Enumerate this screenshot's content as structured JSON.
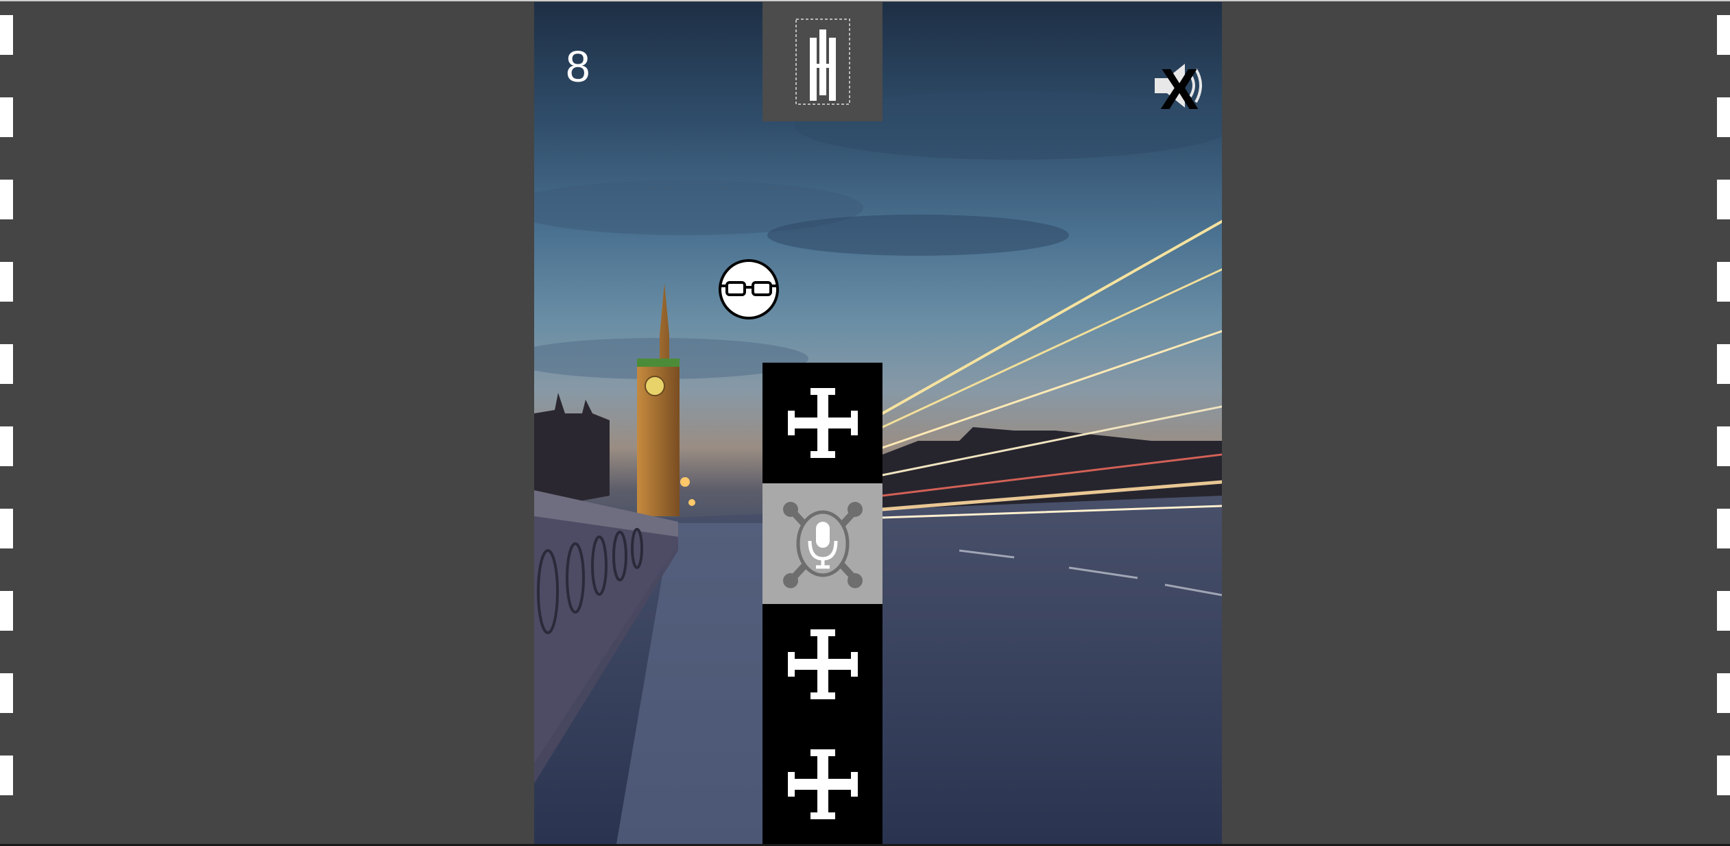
{
  "hud": {
    "score": "8",
    "pause_icon": "pause-icon",
    "sound_icon": "sound-muted-icon"
  },
  "player": {
    "icon": "glasses-face-icon"
  },
  "tower": {
    "blocks": [
      {
        "icon": "cross-icon",
        "state": "normal",
        "color": "#000000"
      },
      {
        "icon": "microphone-tools-icon",
        "state": "selected",
        "color": "#a9a9a9"
      },
      {
        "icon": "cross-icon",
        "state": "normal",
        "color": "#000000"
      },
      {
        "icon": "cross-icon",
        "state": "normal",
        "color": "#000000"
      }
    ]
  },
  "background": {
    "scene": "city-night-bridge-clock-tower",
    "colors": {
      "sky_top": "#1e2f45",
      "horizon": "#9a8d83",
      "road": "#2c3a55",
      "frame": "#454545"
    }
  }
}
